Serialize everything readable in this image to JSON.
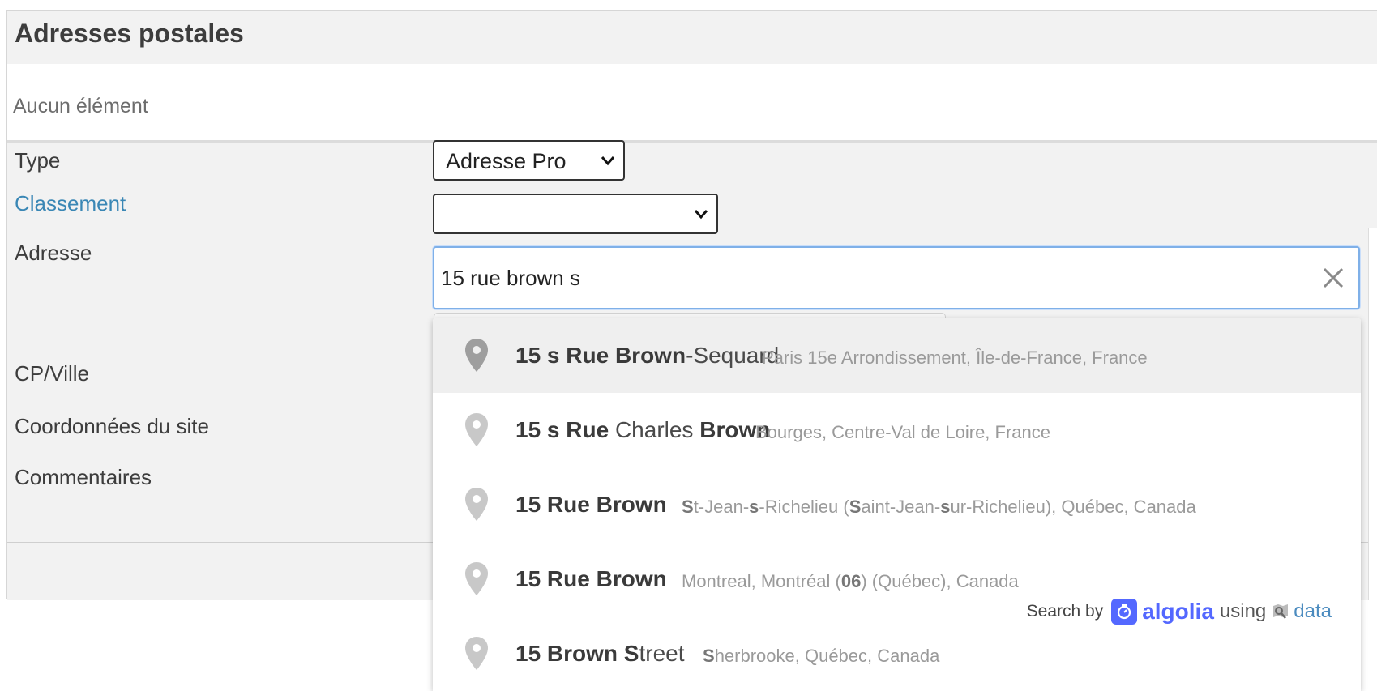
{
  "section": {
    "title": "Adresses postales",
    "empty_text": "Aucun élément"
  },
  "form": {
    "type_label": "Type",
    "type_value": "Adresse Pro",
    "classement_label": "Classement",
    "classement_value": "",
    "adresse_label": "Adresse",
    "adresse_value": "15 rue brown s",
    "cpville_label": "CP/Ville",
    "coord_label": "Coordonnées du site",
    "comment_label": "Commentaires"
  },
  "suggestions": [
    {
      "name_parts": [
        {
          "t": "15 s Rue Brown",
          "b": true
        },
        {
          "t": "-Sequard",
          "b": false
        }
      ],
      "loc_parts": [
        {
          "t": "Paris 15e Arrondissement, Île-de-France, France",
          "b": false
        }
      ]
    },
    {
      "name_parts": [
        {
          "t": "15 s Rue",
          "b": true
        },
        {
          "t": " Charles ",
          "b": false
        },
        {
          "t": "Brown",
          "b": true
        }
      ],
      "loc_parts": [
        {
          "t": "Bourges, Centre-Val de Loire, France",
          "b": false
        }
      ]
    },
    {
      "name_parts": [
        {
          "t": "15 Rue Brown",
          "b": true
        }
      ],
      "loc_parts": [
        {
          "t": "S",
          "b": true
        },
        {
          "t": "t-Jean-",
          "b": false
        },
        {
          "t": "s",
          "b": true
        },
        {
          "t": "-Richelieu (",
          "b": false
        },
        {
          "t": "S",
          "b": true
        },
        {
          "t": "aint-Jean-",
          "b": false
        },
        {
          "t": "s",
          "b": true
        },
        {
          "t": "ur-Richelieu), Québec, Canada",
          "b": false
        }
      ]
    },
    {
      "name_parts": [
        {
          "t": "15 Rue Brown",
          "b": true
        }
      ],
      "loc_parts": [
        {
          "t": "Montreal, Montréal (",
          "b": false
        },
        {
          "t": "06",
          "b": true
        },
        {
          "t": ") (Québec), Canada",
          "b": false
        }
      ]
    },
    {
      "name_parts": [
        {
          "t": "15 Brown S",
          "b": true
        },
        {
          "t": "treet",
          "b": false
        }
      ],
      "loc_parts": [
        {
          "t": "S",
          "b": true
        },
        {
          "t": "herbrooke, Québec, Canada",
          "b": false
        }
      ]
    }
  ],
  "attribution": {
    "search_by": "Search by",
    "brand": "algolia",
    "using": "using",
    "data": "data"
  },
  "icons": {
    "pin": "map-pin-icon",
    "clear": "close-icon",
    "chevron": "chevron-down-icon"
  },
  "colors": {
    "link": "#3a87b5",
    "algolia": "#5468ff",
    "focus_border": "#7fb0e8"
  }
}
